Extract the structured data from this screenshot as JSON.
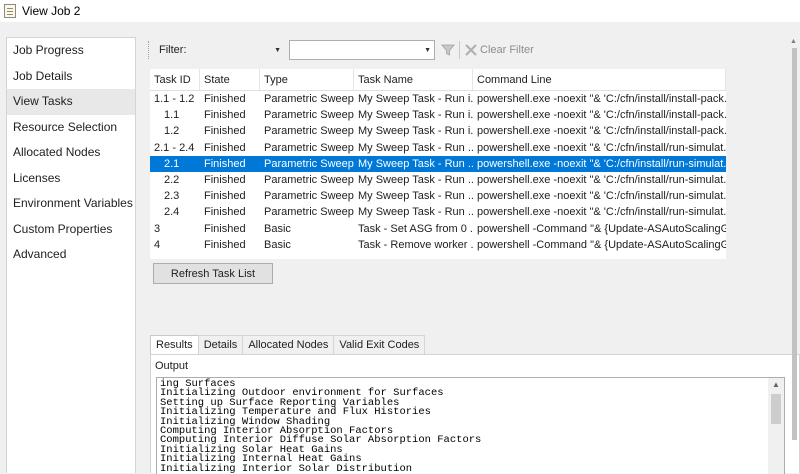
{
  "window": {
    "title": "View Job 2"
  },
  "nav": {
    "items": [
      {
        "label": "Job Progress"
      },
      {
        "label": "Job Details"
      },
      {
        "label": "View Tasks"
      },
      {
        "label": "Resource Selection"
      },
      {
        "label": "Allocated Nodes"
      },
      {
        "label": "Licenses"
      },
      {
        "label": "Environment Variables"
      },
      {
        "label": "Custom Properties"
      },
      {
        "label": "Advanced"
      }
    ],
    "active_index": 2
  },
  "toolbar": {
    "filter_label": "Filter:",
    "filter_field_value": "",
    "filter_value": "",
    "clear_filter_label": "Clear Filter"
  },
  "grid": {
    "columns": [
      "Task ID",
      "State",
      "Type",
      "Task Name",
      "Command Line"
    ],
    "rows": [
      {
        "id": "1.1 - 1.2",
        "state": "Finished",
        "type": "Parametric Sweep",
        "name": "My Sweep Task - Run i...",
        "cmd": "powershell.exe -noexit \"& 'C:/cfn/install/install-pack..."
      },
      {
        "id": "1.1",
        "state": "Finished",
        "type": "Parametric Sweep",
        "name": "My Sweep Task - Run i...",
        "cmd": "powershell.exe -noexit \"& 'C:/cfn/install/install-pack..."
      },
      {
        "id": "1.2",
        "state": "Finished",
        "type": "Parametric Sweep",
        "name": "My Sweep Task - Run i...",
        "cmd": "powershell.exe -noexit \"& 'C:/cfn/install/install-pack..."
      },
      {
        "id": "2.1 - 2.4",
        "state": "Finished",
        "type": "Parametric Sweep",
        "name": "My Sweep Task - Run ...",
        "cmd": "powershell.exe -noexit \"& 'C:/cfn/install/run-simulat..."
      },
      {
        "id": "2.1",
        "state": "Finished",
        "type": "Parametric Sweep",
        "name": "My Sweep Task - Run ...",
        "cmd": "powershell.exe -noexit \"& 'C:/cfn/install/run-simulat..."
      },
      {
        "id": "2.2",
        "state": "Finished",
        "type": "Parametric Sweep",
        "name": "My Sweep Task - Run ...",
        "cmd": "powershell.exe -noexit \"& 'C:/cfn/install/run-simulat..."
      },
      {
        "id": "2.3",
        "state": "Finished",
        "type": "Parametric Sweep",
        "name": "My Sweep Task - Run ...",
        "cmd": "powershell.exe -noexit \"& 'C:/cfn/install/run-simulat..."
      },
      {
        "id": "2.4",
        "state": "Finished",
        "type": "Parametric Sweep",
        "name": "My Sweep Task - Run ...",
        "cmd": "powershell.exe -noexit \"& 'C:/cfn/install/run-simulat..."
      },
      {
        "id": "3",
        "state": "Finished",
        "type": "Basic",
        "name": "Task - Set ASG from 0 ...",
        "cmd": "powershell -Command \"& {Update-ASAutoScalingG..."
      },
      {
        "id": "4",
        "state": "Finished",
        "type": "Basic",
        "name": "Task - Remove worker ...",
        "cmd": "powershell -Command \"& {Update-ASAutoScalingG..."
      }
    ],
    "selected_index": 4,
    "selection_color": "#0078d7"
  },
  "refresh_button": {
    "label": "Refresh Task List"
  },
  "detail_tabs": {
    "tabs": [
      {
        "label": "Results"
      },
      {
        "label": "Details"
      },
      {
        "label": "Allocated Nodes"
      },
      {
        "label": "Valid Exit Codes"
      }
    ],
    "active_index": 0
  },
  "results": {
    "output_label": "Output",
    "lines": [
      "ing Surfaces",
      "Initializing Outdoor environment for Surfaces",
      "Setting up Surface Reporting Variables",
      "Initializing Temperature and Flux Histories",
      "Initializing Window Shading",
      "Computing Interior Absorption Factors",
      "Computing Interior Diffuse Solar Absorption Factors",
      "Initializing Solar Heat Gains",
      "Initializing Internal Heat Gains",
      "Initializing Interior Solar Distribution"
    ]
  }
}
